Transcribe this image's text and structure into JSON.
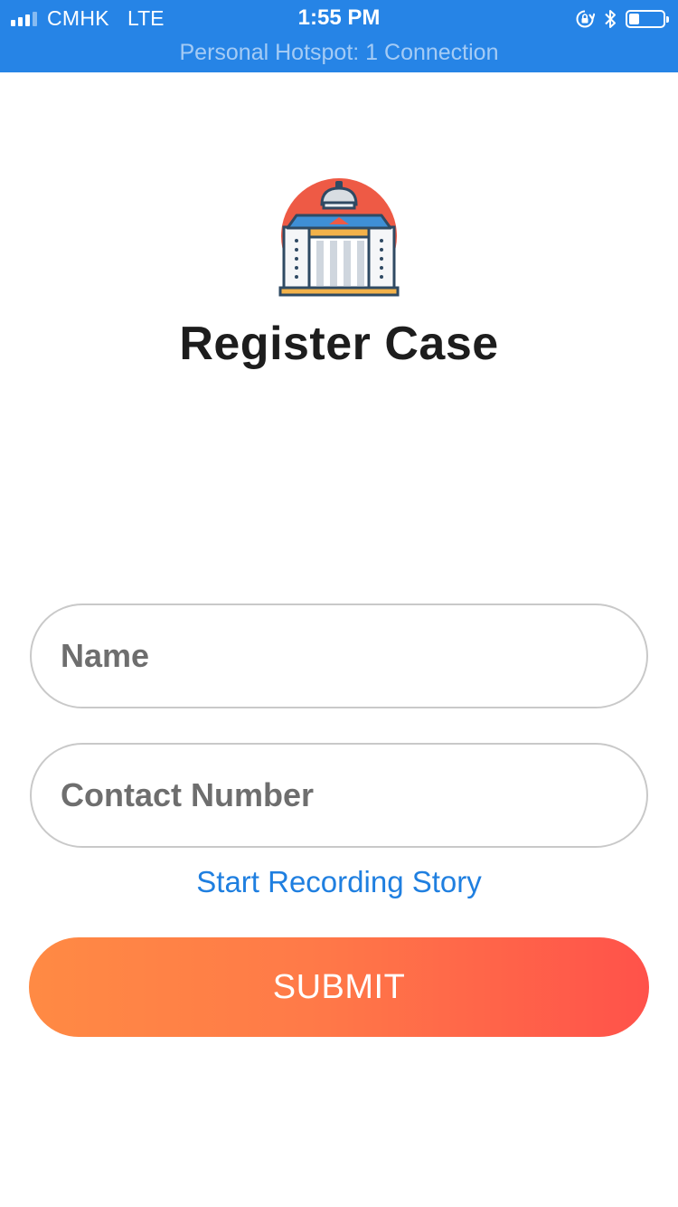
{
  "status_bar": {
    "carrier": "CMHK",
    "network": "LTE",
    "time": "1:55 PM",
    "hotspot": "Personal Hotspot: 1 Connection",
    "battery_level": 0.3,
    "signal_bars": 3,
    "icons": [
      "signal-bars-icon",
      "rotation-lock-icon",
      "bluetooth-icon",
      "battery-icon"
    ]
  },
  "header": {
    "logo_icon": "courthouse-icon",
    "title": "Register Case"
  },
  "form": {
    "name_placeholder": "Name",
    "contact_placeholder": "Contact Number",
    "record_link": "Start Recording Story",
    "submit_label": "SUBMIT"
  },
  "colors": {
    "status_bar": "#2684e6",
    "link": "#1f7fe0",
    "submit_start": "#ff8a44",
    "submit_end": "#ff524a",
    "logo_circle": "#ee5a45"
  }
}
